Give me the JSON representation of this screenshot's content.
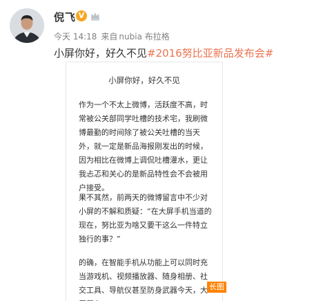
{
  "post": {
    "username": "倪飞",
    "verified_badge": "V",
    "time": "今天 14:18",
    "source_prefix": "来自",
    "source": "nubia 布拉格",
    "text_main": "小屏你好，好久不见",
    "hashtag": "#2016努比亚新品发布会#"
  },
  "image_card": {
    "title": "小屏你好，好久不见",
    "paragraphs": [
      "作为一个不太上微博，活跃度不高，时常被公关部同学吐槽的技术宅，我刷微博最勤的时间除了被公关吐槽的当天外，就一定是新品海报刚发出的时候，因为相比在微博上调侃吐槽灌水，更让我忐忑和关心的是新品特性会不会被用户接受。",
      "果不其然，前两天的微博留言中不少对小屏的不解和质疑：“在大屏手机当道的现在，努比亚为啥又要干这么一件特立独行的事？”",
      "的确，在智能手机从功能上可以同时充当游戏机、视频播放器、随身相册、社交工具、导航仪甚至防身武器今天，大屏幕在"
    ],
    "long_image_label": "长图"
  },
  "colors": {
    "hashtag": "#eb7350",
    "verified": "#f5a623",
    "long_image_tag": "#ff8200"
  }
}
